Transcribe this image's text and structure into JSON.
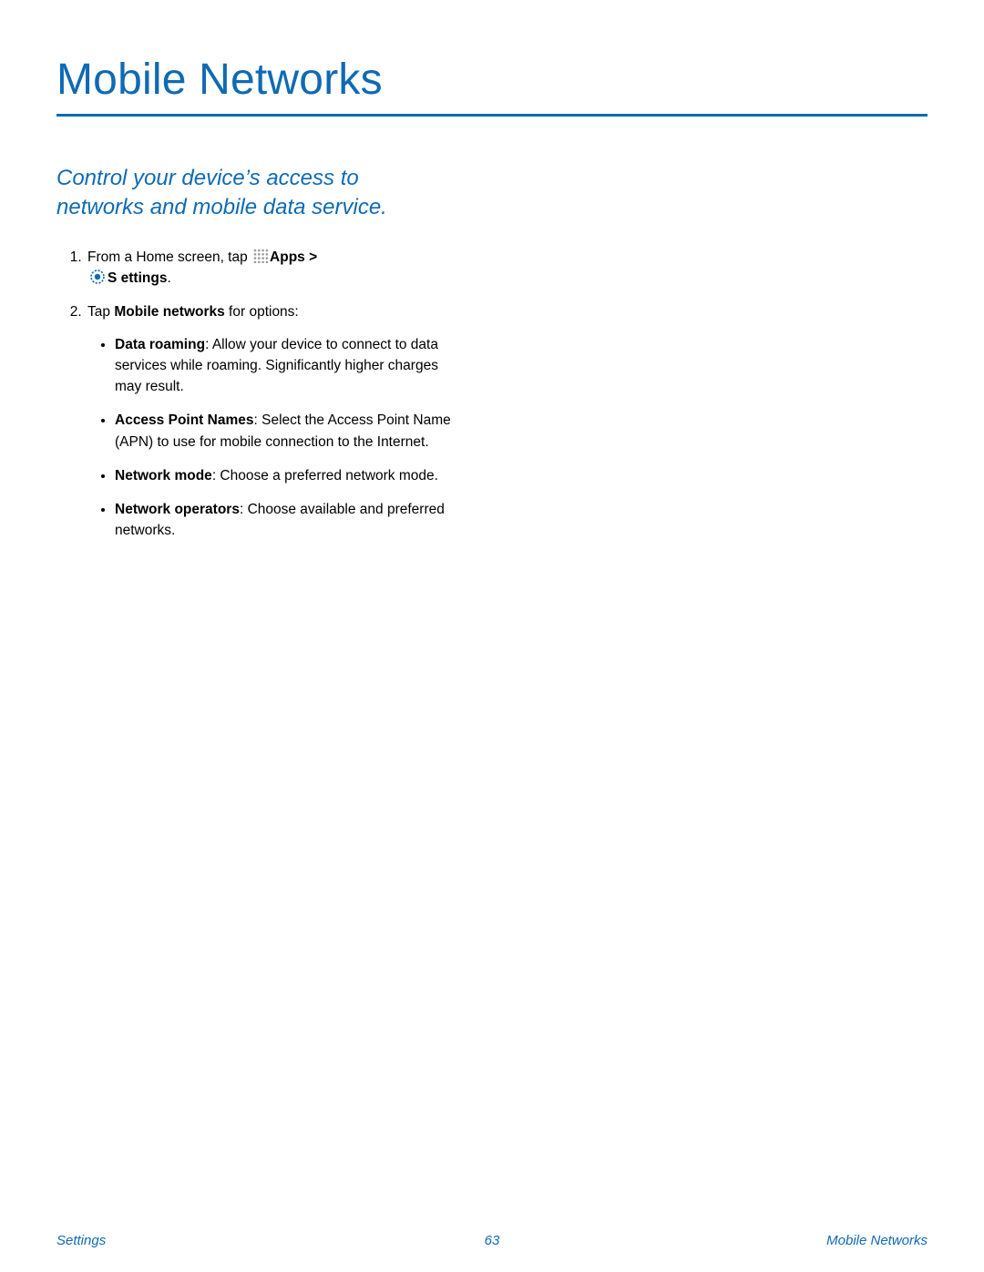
{
  "header": {
    "title": "Mobile Networks"
  },
  "intro": "Control your device’s access to networks and mobile data service.",
  "steps": {
    "one": {
      "pre": "From a Home screen, tap ",
      "apps": "Apps",
      "sep": " > ",
      "settings": "S ettings",
      "post": "."
    },
    "two": {
      "pre": "Tap ",
      "link": "Mobile networks",
      "post": " for options:"
    }
  },
  "bullets": {
    "data_roaming": {
      "term": "Data roaming",
      "desc": ": Allow your device to connect to data services while roaming. Significantly higher charges may result."
    },
    "apn": {
      "term": "Access Point Names",
      "desc": ": Select the Access Point Name (APN) to use for mobile connection to the Internet."
    },
    "network_mode": {
      "term": "Network mode",
      "desc": ": Choose a preferred network mode."
    },
    "network_operators": {
      "term": "Network operators",
      "desc": ": Choose available and preferred networks."
    }
  },
  "footer": {
    "left": "Settings",
    "page": "63",
    "right": "Mobile Networks"
  }
}
